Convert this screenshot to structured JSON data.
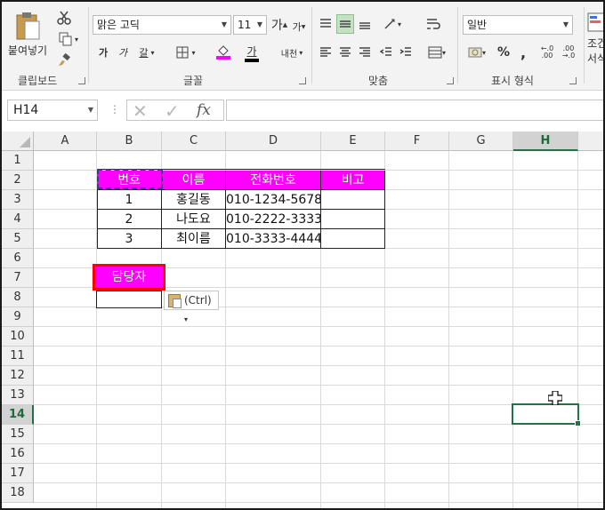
{
  "ribbon": {
    "clipboard": {
      "paste_label": "붙여넣기",
      "group_label": "클립보드"
    },
    "font": {
      "font_name": "맑은 고딕",
      "font_size": "11",
      "grow_label": "가",
      "shrink_label": "가",
      "bold_label": "가",
      "italic_label": "가",
      "underline_label": "갈",
      "font_color_label": "가",
      "phonetic_label": "내천",
      "group_label": "글꼴"
    },
    "alignment": {
      "group_label": "맞춤"
    },
    "number": {
      "format_value": "일반",
      "percent_label": "%",
      "comma_label": ",",
      "inc_decimal_label": ".00",
      "dec_decimal_label": ".00",
      "group_label": "표시 형식"
    },
    "styles": {
      "cond_label": "조건",
      "cut_label": "서식"
    },
    "colors": {
      "accent": "#217346",
      "magenta": "#ff00ff",
      "red": "#ff0000"
    }
  },
  "formula_bar": {
    "name_box": "H14",
    "fx_label": "fx",
    "formula": ""
  },
  "sheet": {
    "columns": [
      "A",
      "B",
      "C",
      "D",
      "E",
      "F",
      "G",
      "H"
    ],
    "rows": [
      "1",
      "2",
      "3",
      "4",
      "5",
      "6",
      "7",
      "8",
      "9",
      "10",
      "11",
      "12",
      "13",
      "14",
      "15",
      "16",
      "17",
      "18"
    ],
    "selected_column": "H",
    "selected_row": "14",
    "table": {
      "headers": [
        "번호",
        "이름",
        "전화번호",
        "비고"
      ],
      "rows": [
        [
          "1",
          "홍길동",
          "010-1234-5678",
          ""
        ],
        [
          "2",
          "나도요",
          "010-2222-3333",
          ""
        ],
        [
          "3",
          "최이름",
          "010-3333-4444",
          ""
        ]
      ]
    },
    "manager_label": "담당자",
    "paste_options_label": "(Ctrl)"
  }
}
